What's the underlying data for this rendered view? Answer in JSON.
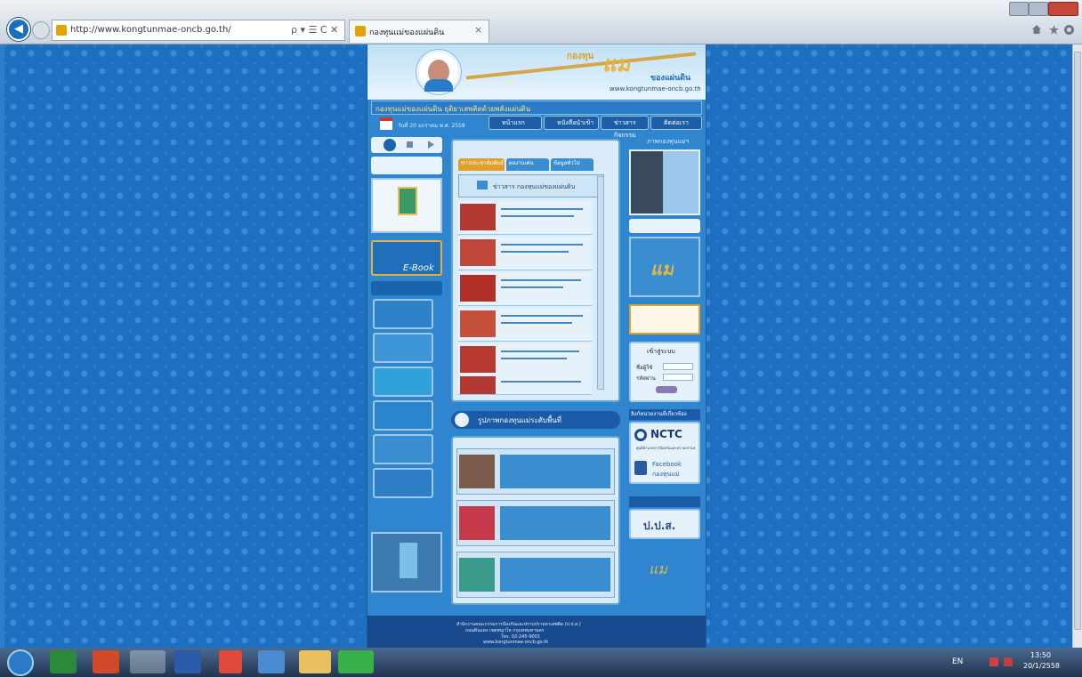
{
  "browser": {
    "address_url": "http://www.kongtunmae-oncb.go.th/",
    "address_controls": "ρ ▾ ☰ C ✕",
    "tab_title": "กองทุนแม่ของแผ่นดิน",
    "tab_close": "×"
  },
  "site": {
    "url_line": "www.kongtunmae-oncb.go.th",
    "logo_text_1": "กองทุน",
    "logo_text_2": "แม่",
    "logo_text_3": "ของแผ่นดิน",
    "marquee": "กองทุนแม่ของแผ่นดิน ยุติยาเสพติดด้วยพลังแผ่นดิน",
    "date": "วันที่ 20 มกราคม พ.ศ. 2558",
    "nav": [
      "หน้าแรก",
      "หนังสือนำเข้า",
      "ข่าวสารกิจกรรม",
      "ติดต่อเรา"
    ],
    "tabs": [
      "ข่าวประชาสัมพันธ์",
      "ผลงานเด่น",
      "ข้อมูลทั่วไป"
    ],
    "news_header": "ข่าวสาร กองทุนแม่ของแผ่นดิน",
    "gallery_title": "รูปภาพกองทุนแม่ระดับพื้นที่",
    "ebook": "E-Book",
    "right_title": "ภาพกองทุนแม่ฯ",
    "links_title": "ลิงก์หน่วยงานที่เกี่ยวข้อง",
    "nctc": "NCTC",
    "nctc_sub": "ศูนย์อำนวยการป้องกันและปราบปรามยาเสพติด",
    "facebook_label": "Facebook",
    "facebook_sub": "กองทุนแม่",
    "oncb_label": "ป.ป.ส.",
    "login_title": "เข้าสู่ระบบ",
    "login_user": "ชื่อผู้ใช้",
    "login_pass": "รหัสผ่าน",
    "login_btn": "เข้าสู่ระบบ",
    "footer_1": "สำนักงานคณะกรรมการป้องกันและปราบปรามยาเสพติด (ป.ป.ส.)",
    "footer_2": "ถนนดินแดง เขตพญาไท กรุงเทพมหานคร",
    "footer_3": "โทร. 02-245-9001",
    "footer_4": "www.kongtunmae-oncb.go.th"
  },
  "taskbar": {
    "lang": "EN",
    "time": "13:50",
    "date": "20/1/2558"
  }
}
